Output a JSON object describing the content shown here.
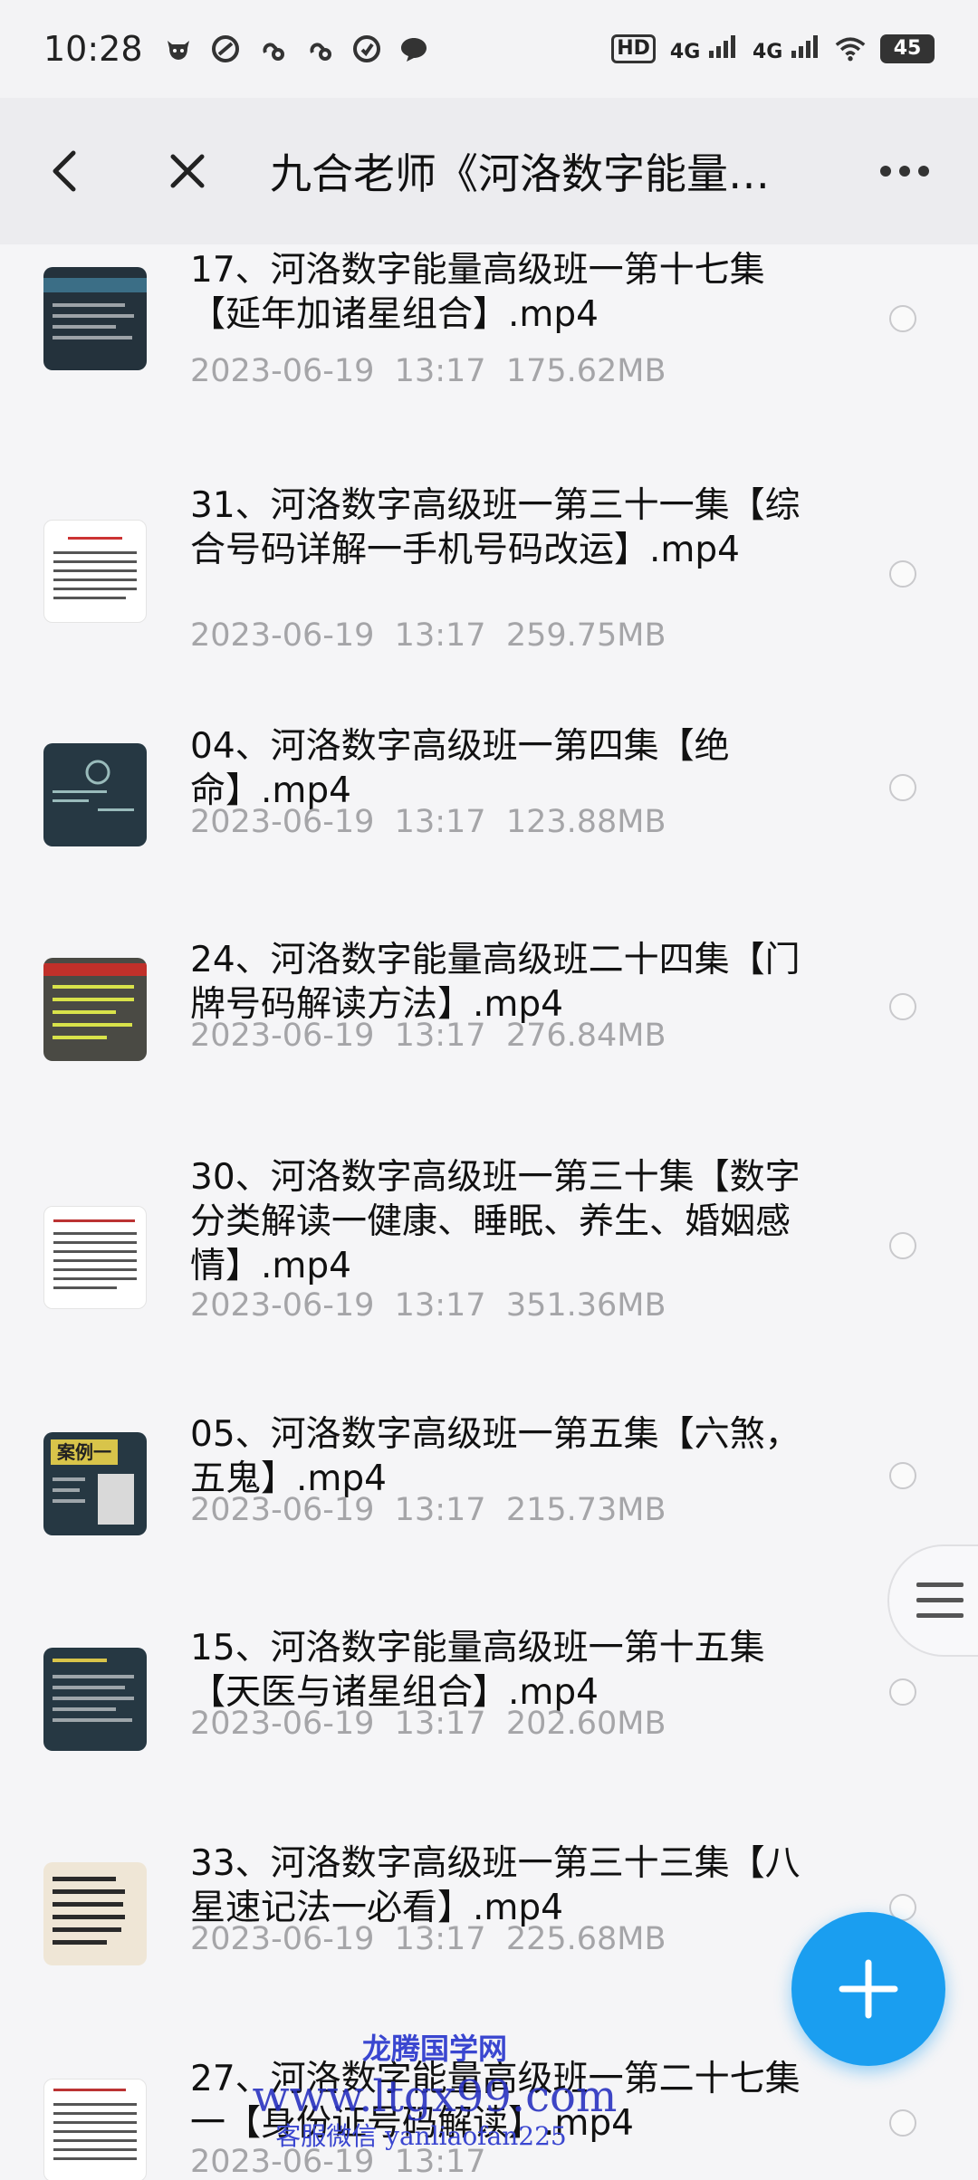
{
  "status_bar": {
    "time": "10:28",
    "left_icons": [
      "cow-app-icon",
      "circle-app-icon",
      "link-icon",
      "link-icon",
      "compass-icon",
      "chat-bubble-icon"
    ],
    "hd_label": "HD",
    "net1": "4G",
    "net2": "4G",
    "battery": "45"
  },
  "nav": {
    "title": "九合老师《河洛数字能量…"
  },
  "items": [
    {
      "title": "17、河洛数字能量高级班一第十七集【延年加诸星组合】.mp4",
      "date": "2023-06-19",
      "time": "13:17",
      "size": "175.62MB",
      "thumb": "dark"
    },
    {
      "title": "31、河洛数字高级班一第三十一集【综合号码详解一手机号码改运】.mp4",
      "date": "2023-06-19",
      "time": "13:17",
      "size": "259.75MB",
      "thumb": "light"
    },
    {
      "title": "04、河洛数字高级班一第四集【绝命】.mp4",
      "date": "2023-06-19",
      "time": "13:17",
      "size": "123.88MB",
      "thumb": "dark"
    },
    {
      "title": "24、河洛数字能量高级班二十四集【门牌号码解读方法】.mp4",
      "date": "2023-06-19",
      "time": "13:17",
      "size": "276.84MB",
      "thumb": "dark-gold"
    },
    {
      "title": "30、河洛数字高级班一第三十集【数字分类解读一健康、睡眠、养生、婚姻感情】.mp4",
      "date": "2023-06-19",
      "time": "13:17",
      "size": "351.36MB",
      "thumb": "light"
    },
    {
      "title": "05、河洛数字高级班一第五集【六煞，五鬼】.mp4",
      "date": "2023-06-19",
      "time": "13:17",
      "size": "215.73MB",
      "thumb": "dark"
    },
    {
      "title": "15、河洛数字能量高级班一第十五集【天医与诸星组合】.mp4",
      "date": "2023-06-19",
      "time": "13:17",
      "size": "202.60MB",
      "thumb": "dark"
    },
    {
      "title": "33、河洛数字高级班一第三十三集【八星速记法一必看】.mp4",
      "date": "2023-06-19",
      "time": "13:17",
      "size": "225.68MB",
      "thumb": "beige"
    },
    {
      "title": "27、河洛数字能量高级班一第二十七集一【身份证号码解读】.mp4",
      "date": "2023-06-19",
      "time": "13:17",
      "size": "",
      "thumb": "light"
    }
  ],
  "watermark": {
    "line1": "龙腾国学网",
    "line2": "www.ltgx99.com",
    "line3": "客服微信 yanliaofan225"
  }
}
